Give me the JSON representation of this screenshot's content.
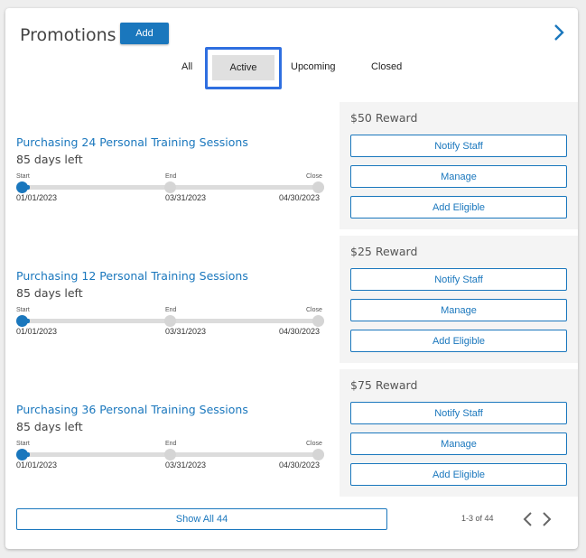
{
  "header": {
    "title": "Promotions",
    "add_label": "Add"
  },
  "tabs": [
    {
      "label": "All"
    },
    {
      "label": "Active",
      "selected": true
    },
    {
      "label": "Upcoming"
    },
    {
      "label": "Closed"
    }
  ],
  "promotions": [
    {
      "name": "Purchasing 24 Personal Training Sessions",
      "days_left": "85 days left",
      "reward": "$50 Reward",
      "progress_fraction": 0.03,
      "timeline": {
        "start_label": "Start",
        "end_label": "End",
        "close_label": "Close",
        "start_date": "01/01/2023",
        "end_date": "03/31/2023",
        "close_date": "04/30/2023"
      },
      "actions": {
        "notify": "Notify Staff",
        "manage": "Manage",
        "add_eligible": "Add Eligible"
      }
    },
    {
      "name": "Purchasing 12 Personal Training Sessions",
      "days_left": "85 days left",
      "reward": "$25 Reward",
      "progress_fraction": 0.03,
      "timeline": {
        "start_label": "Start",
        "end_label": "End",
        "close_label": "Close",
        "start_date": "01/01/2023",
        "end_date": "03/31/2023",
        "close_date": "04/30/2023"
      },
      "actions": {
        "notify": "Notify Staff",
        "manage": "Manage",
        "add_eligible": "Add Eligible"
      }
    },
    {
      "name": "Purchasing 36 Personal Training Sessions",
      "days_left": "85 days left",
      "reward": "$75 Reward",
      "progress_fraction": 0.03,
      "timeline": {
        "start_label": "Start",
        "end_label": "End",
        "close_label": "Close",
        "start_date": "01/01/2023",
        "end_date": "03/31/2023",
        "close_date": "04/30/2023"
      },
      "actions": {
        "notify": "Notify Staff",
        "manage": "Manage",
        "add_eligible": "Add Eligible"
      }
    }
  ],
  "footer": {
    "show_all_label": "Show All 44",
    "page_info": "1-3 of 44"
  },
  "icons": {
    "header_next": "chevron-right-icon",
    "page_prev": "chevron-left-icon",
    "page_next": "chevron-right-icon"
  },
  "colors": {
    "accent": "#1a77bd",
    "focus_outline": "#2f6fe0",
    "selected_tab_bg": "#e0e0e0",
    "side_panel_bg": "#f4f4f4"
  }
}
